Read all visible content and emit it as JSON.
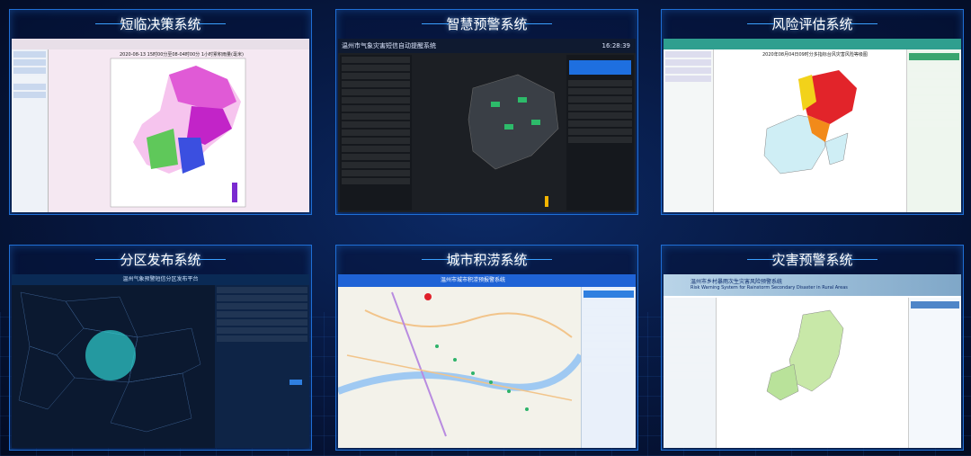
{
  "cards": [
    {
      "title": "短临决策系统",
      "map_title": "2020-08-13 15时00分至08-04时00分 1小时累积雨量(毫米)"
    },
    {
      "title": "智慧预警系统",
      "app_title": "温州市气象灾害短信自动提醒系统",
      "clock": "16:28:39"
    },
    {
      "title": "风险评估系统",
      "map_title": "2020年08月04日09时分多指标台风灾害风险等级图"
    },
    {
      "title": "分区发布系统",
      "app_title": "温州气象预警短信分区发布平台"
    },
    {
      "title": "城市积涝系统",
      "app_title": "温州市城市积涝预报警系统"
    },
    {
      "title": "灾害预警系统",
      "app_title": "温州市乡村暴雨次生灾害风险预警系统",
      "subtitle": "Risk Warning System for Rainstorm Secondary Disaster in Rural Areas"
    }
  ],
  "colors": {
    "frame": "#1f6fd6",
    "title": "#ffffff",
    "bg": "#071a45"
  }
}
